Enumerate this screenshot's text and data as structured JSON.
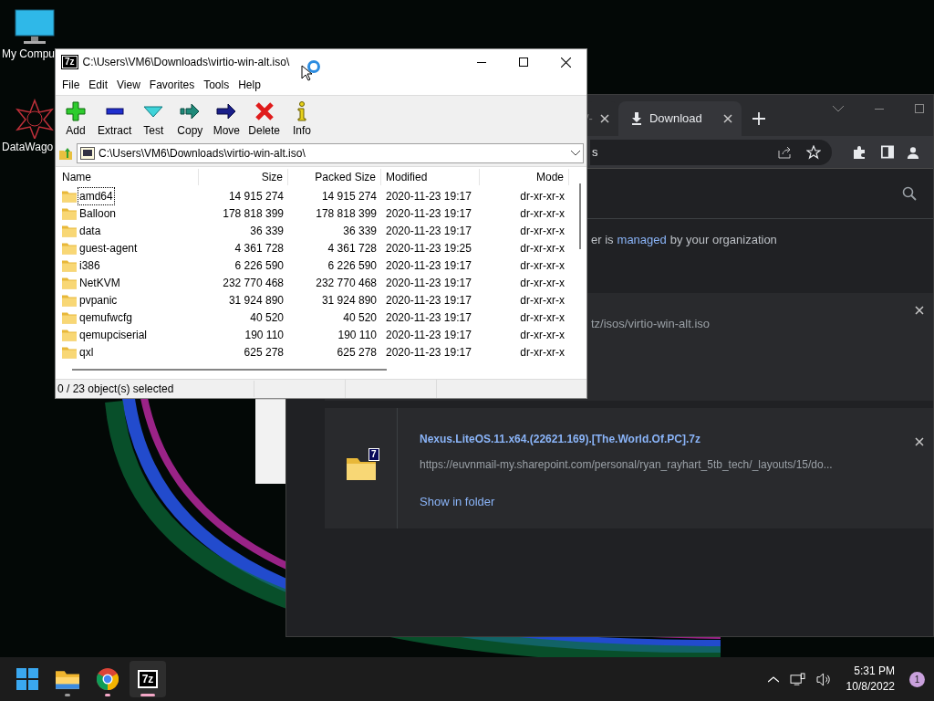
{
  "desktop_icons": [
    {
      "label": "My Compu",
      "kind": "computer"
    },
    {
      "label": "DataWago",
      "kind": "app"
    }
  ],
  "browser": {
    "tabs": [
      {
        "label": "/-",
        "selected": false
      },
      {
        "label": "Download",
        "selected": true
      }
    ],
    "address": "s",
    "notice": {
      "before": "er is",
      "link": "managed",
      "after": "by your organization"
    },
    "downloads": [
      {
        "url": "tz/isos/virtio-win-alt.iso"
      },
      {
        "name": "Nexus.LiteOS.11.x64.(22621.169).[The.World.Of.PC].7z",
        "url": "https://euvnmail-my.sharepoint.com/personal/ryan_rayhart_5tb_tech/_layouts/15/do...",
        "action": "Show in folder",
        "badge": "7"
      }
    ]
  },
  "sevenzip": {
    "logo": "7z",
    "title": "C:\\Users\\VM6\\Downloads\\virtio-win-alt.iso\\",
    "menu": [
      "File",
      "Edit",
      "View",
      "Favorites",
      "Tools",
      "Help"
    ],
    "toolbar": [
      {
        "label": "Add",
        "kind": "add"
      },
      {
        "label": "Extract",
        "kind": "extract"
      },
      {
        "label": "Test",
        "kind": "test"
      },
      {
        "label": "Copy",
        "kind": "copy"
      },
      {
        "label": "Move",
        "kind": "move"
      },
      {
        "label": "Delete",
        "kind": "delete"
      },
      {
        "label": "Info",
        "kind": "info"
      }
    ],
    "address": "C:\\Users\\VM6\\Downloads\\virtio-win-alt.iso\\",
    "columns": [
      "Name",
      "Size",
      "Packed Size",
      "Modified",
      "Mode"
    ],
    "rows": [
      {
        "name": "amd64",
        "size": "14 915 274",
        "packed": "14 915 274",
        "modified": "2020-11-23 19:17",
        "mode": "dr-xr-xr-x",
        "focused": true
      },
      {
        "name": "Balloon",
        "size": "178 818 399",
        "packed": "178 818 399",
        "modified": "2020-11-23 19:17",
        "mode": "dr-xr-xr-x",
        "focused": false
      },
      {
        "name": "data",
        "size": "36 339",
        "packed": "36 339",
        "modified": "2020-11-23 19:17",
        "mode": "dr-xr-xr-x",
        "focused": false
      },
      {
        "name": "guest-agent",
        "size": "4 361 728",
        "packed": "4 361 728",
        "modified": "2020-11-23 19:25",
        "mode": "dr-xr-xr-x",
        "focused": false
      },
      {
        "name": "i386",
        "size": "6 226 590",
        "packed": "6 226 590",
        "modified": "2020-11-23 19:17",
        "mode": "dr-xr-xr-x",
        "focused": false
      },
      {
        "name": "NetKVM",
        "size": "232 770 468",
        "packed": "232 770 468",
        "modified": "2020-11-23 19:17",
        "mode": "dr-xr-xr-x",
        "focused": false
      },
      {
        "name": "pvpanic",
        "size": "31 924 890",
        "packed": "31 924 890",
        "modified": "2020-11-23 19:17",
        "mode": "dr-xr-xr-x",
        "focused": false
      },
      {
        "name": "qemufwcfg",
        "size": "40 520",
        "packed": "40 520",
        "modified": "2020-11-23 19:17",
        "mode": "dr-xr-xr-x",
        "focused": false
      },
      {
        "name": "qemupciserial",
        "size": "190 110",
        "packed": "190 110",
        "modified": "2020-11-23 19:17",
        "mode": "dr-xr-xr-x",
        "focused": false
      },
      {
        "name": "qxl",
        "size": "625 278",
        "packed": "625 278",
        "modified": "2020-11-23 19:17",
        "mode": "dr-xr-xr-x",
        "focused": false
      }
    ],
    "status": "0 / 23 object(s) selected"
  },
  "taskbar": {
    "apps": [
      {
        "kind": "start",
        "active": false
      },
      {
        "kind": "explorer",
        "active": false,
        "color": "#9a9a9a"
      },
      {
        "kind": "chrome",
        "active": false,
        "color": "#f4a7c7"
      },
      {
        "kind": "sevenzip",
        "label": "7z",
        "active": true,
        "color": "#f4a7c7"
      }
    ],
    "time": "5:31 PM",
    "date": "10/8/2022",
    "notifications": "1"
  }
}
